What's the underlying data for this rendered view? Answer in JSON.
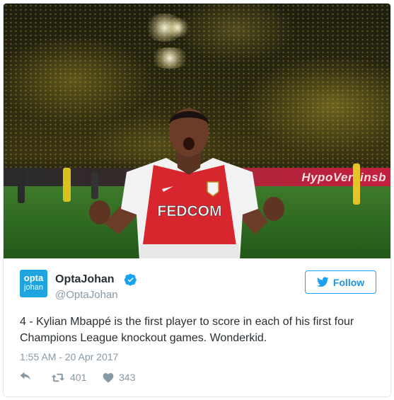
{
  "tweet": {
    "author": {
      "name": "OptaJohan",
      "handle": "@OptaJohan",
      "avatar_line1": "opta",
      "avatar_line2": "johan"
    },
    "follow_label": "Follow",
    "text": "4 - Kylian Mbappé is the first player to score in each of his first four Champions League knockout games. Wonderkid.",
    "timestamp": "1:55 AM - 20 Apr 2017",
    "retweets": "401",
    "likes": "343"
  },
  "photo": {
    "shirt_text": "FEDCOM",
    "ad_text": "HypoVereinsb"
  },
  "colors": {
    "twitter_blue": "#1da1f2",
    "avatar_blue": "#1fa4df",
    "text": "#292f33",
    "muted": "#8899a6",
    "border": "#e1e8ed"
  },
  "icons": [
    "verified-icon",
    "twitter-bird-icon",
    "reply-icon",
    "retweet-icon",
    "heart-icon"
  ]
}
